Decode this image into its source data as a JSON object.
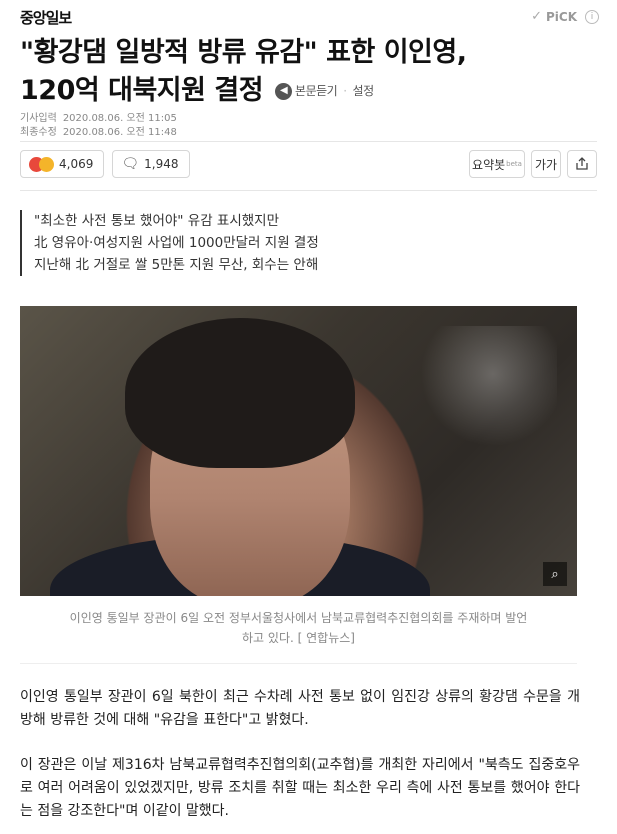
{
  "header": {
    "logo": "중앙일보",
    "pick_label": "PiCK",
    "pick_check_icon": "checkmark-icon",
    "info_icon": "info-icon",
    "info_symbol": "i"
  },
  "article": {
    "title_line1": "\"황강댐 일방적 방류 유감\" 표한 이인영,",
    "title_line2": "120억 대북지원 결정",
    "listen_label": "본문듣기",
    "settings_label": "설정",
    "published_label": "기사입력",
    "published_value": "2020.08.06. 오전 11:05",
    "modified_label": "최종수정",
    "modified_value": "2020.08.06. 오전 11:48"
  },
  "toolbar": {
    "reaction_count": "4,069",
    "comment_count": "1,948",
    "summary_label": "요약봇",
    "summary_beta": "beta",
    "font_label": "가가",
    "share_icon": "share-icon"
  },
  "summary": [
    "\"최소한 사전 통보 했어야\" 유감 표시했지만",
    "北 영유아·여성지원 사업에 1000만달러 지원 결정",
    "지난해 北 거절로 쌀 5만톤 지원 무산, 회수는 안해"
  ],
  "photo": {
    "caption_line1": "이인영 통일부 장관이 6일 오전 정부서울청사에서 남북교류협력추진협의회를 주재하며 발언",
    "caption_line2": "하고 있다. [ 연합뉴스]",
    "zoom_icon": "zoom-icon"
  },
  "body": [
    "이인영 통일부 장관이 6일 북한이 최근 수차례 사전 통보 없이 임진강 상류의 황강댐 수문을 개방해 방류한 것에 대해 \"유감을 표한다\"고 밝혔다.",
    "이 장관은 이날 제316차 남북교류협력추진협의회(교추협)를 개최한 자리에서 \"북측도 집중호우로 여러 어려움이 있었겠지만, 방류 조치를 취할 때는 최소한 우리 측에 사전 통보를 했어야 한다는 점을 강조한다\"며 이같이 말했다."
  ],
  "colors": {
    "reaction_red": "#e8483b",
    "reaction_yellow": "#f4b42a"
  }
}
